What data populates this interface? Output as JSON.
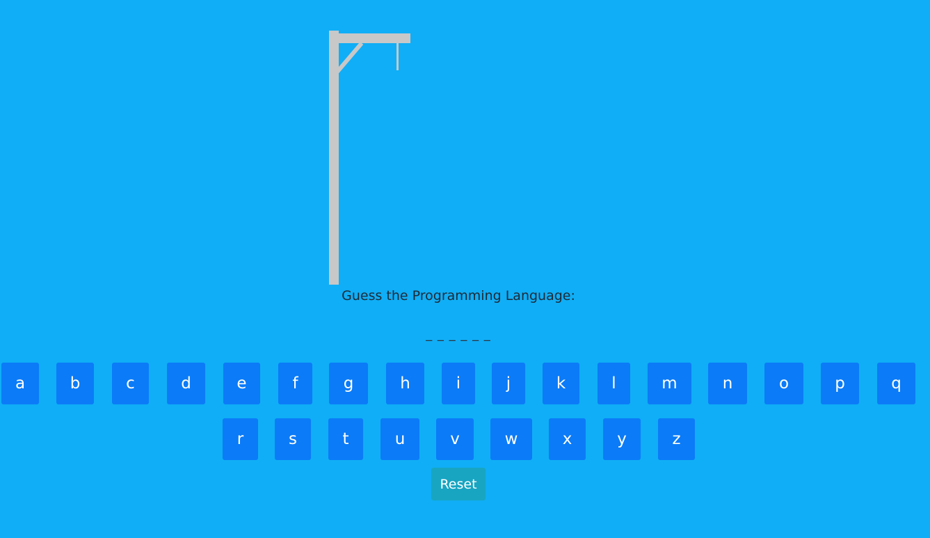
{
  "game": {
    "prompt": "Guess the Programming Language:",
    "masked_word": "_ _ _ _ _ _",
    "letters_row1": [
      "a",
      "b",
      "c",
      "d",
      "e",
      "f",
      "g",
      "h",
      "i",
      "j",
      "k",
      "l",
      "m",
      "n",
      "o",
      "p",
      "q"
    ],
    "letters_row2": [
      "r",
      "s",
      "t",
      "u",
      "v",
      "w",
      "x",
      "y",
      "z"
    ],
    "reset_label": "Reset"
  },
  "colors": {
    "background": "#10aef6",
    "key_button": "#0b7bf8",
    "reset_button": "#18a5c2",
    "gallows": "#c8c8c8"
  }
}
